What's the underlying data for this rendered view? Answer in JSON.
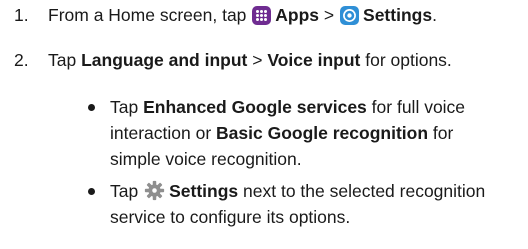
{
  "steps": [
    {
      "number": "1.",
      "t1": "From a Home screen, tap",
      "apps": "Apps",
      "sep": ">",
      "settings": "Settings",
      "end": "."
    },
    {
      "number": "2.",
      "t1": "Tap",
      "lang": "Language and input",
      "sep": ">",
      "voice": "Voice input",
      "end": "for options."
    }
  ],
  "bullets": [
    {
      "l1a": "Tap",
      "l1b": "Enhanced Google services",
      "l1c": "for full voice",
      "l2a": "interaction or",
      "l2b": "Basic Google recognition",
      "l2c": "for",
      "l3": "simple voice recognition."
    },
    {
      "l1a": "Tap",
      "l1b": "Settings",
      "l1c": "next to the selected recognition",
      "l2": "service to configure its options."
    }
  ],
  "colors": {
    "apps_icon": "#6f2c91",
    "settings_icon": "#2f8fd6",
    "gear_icon": "#8f8f8f",
    "text": "#1a1a1a"
  },
  "icons": [
    "apps-icon",
    "settings-icon",
    "gear-icon"
  ]
}
